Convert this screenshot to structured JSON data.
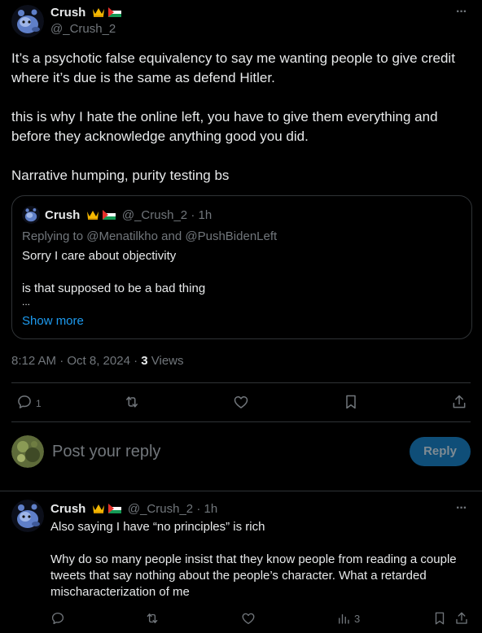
{
  "main_tweet": {
    "display_name": "Crush",
    "handle": "@_Crush_2",
    "more_label": "···",
    "paragraphs": [
      "It’s a psychotic false equivalency to say me wanting people to give credit where it’s due is the same as defend Hitler.",
      "this is why I hate the online left, you have to give them everything and before they acknowledge anything good you did.",
      "Narrative humping, purity testing bs"
    ],
    "timestamp": "8:12 AM · Oct 8, 2024 · ",
    "views_count": "3",
    "views_label": " Views",
    "actions": {
      "reply_count": "1"
    }
  },
  "quoted_tweet": {
    "display_name": "Crush",
    "handle": "@_Crush_2",
    "time": "· 1h",
    "replying_prefix": "Replying to ",
    "replying_to_1": "@Menatilkho",
    "replying_and": " and ",
    "replying_to_2": "@PushBidenLeft",
    "line1": "Sorry I care about objectivity",
    "line2": "is that supposed to be a bad thing",
    "ellipsis": "...",
    "show_more": "Show more"
  },
  "composer": {
    "placeholder": "Post your reply",
    "reply_button": "Reply"
  },
  "reply_tweet": {
    "display_name": "Crush",
    "handle": "@_Crush_2",
    "time": "· 1h",
    "more_label": "···",
    "paragraphs": [
      "Also saying I have “no principles” is rich",
      "Why do so many people insist that they know people from reading a couple tweets that say nothing about the people’s character. What a retarded mischaracterization of me"
    ],
    "views_count": "3"
  },
  "colors": {
    "background": "#000000",
    "text": "#e7e9ea",
    "secondary": "#71767b",
    "link": "#1d9bf0",
    "divider": "#2f3336",
    "reply_button_bg": "#0f4e78",
    "reply_button_text": "#7f8b93",
    "crown_gold": "#f5b800"
  },
  "icons": [
    "avatar-blue-creature",
    "crown-emoji",
    "palestine-flag",
    "reply-icon",
    "retweet-icon",
    "like-icon",
    "bookmark-icon",
    "share-icon",
    "views-icon"
  ]
}
